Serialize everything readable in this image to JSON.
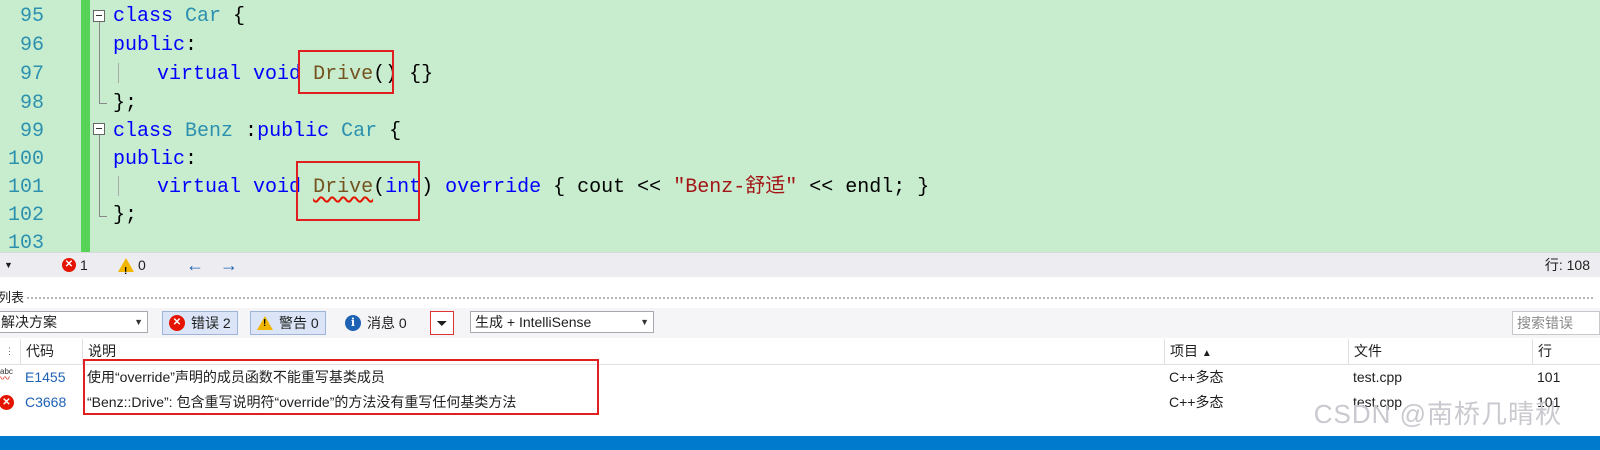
{
  "editor": {
    "lines": [
      {
        "num": "95"
      },
      {
        "num": "96"
      },
      {
        "num": "97"
      },
      {
        "num": "98"
      },
      {
        "num": "99"
      },
      {
        "num": "100"
      },
      {
        "num": "101"
      },
      {
        "num": "102"
      },
      {
        "num": "103"
      }
    ],
    "code": {
      "l95_kw": "class",
      "l95_name": "Car",
      "l95_rest": " {",
      "l96_kw": "public",
      "l96_rest": ":",
      "l97_kw1": "virtual",
      "l97_kw2": "void",
      "l97_fn": "Drive",
      "l97_rest": "() {}",
      "l98": "};",
      "l99_kw": "class",
      "l99_name": "Benz",
      "l99_mid": " :",
      "l99_kw2": "public",
      "l99_base": "Car",
      "l99_rest": " {",
      "l100_kw": "public",
      "l100_rest": ":",
      "l101_kw1": "virtual",
      "l101_kw2": "void",
      "l101_fn": "Drive",
      "l101_p1": "(",
      "l101_int": "int",
      "l101_p2": ")",
      "l101_override": "override",
      "l101_body1": " { cout << ",
      "l101_str": "\"Benz-舒适\"",
      "l101_body2": " << endl; }",
      "l102": "};"
    }
  },
  "status": {
    "errors": "1",
    "warnings": "0",
    "line_info": "行: 108"
  },
  "panel": {
    "title": "列表",
    "scope": "解决方案",
    "errors_btn": "错误 2",
    "warnings_btn": "警告 0",
    "messages_btn": "消息 0",
    "build_filter": "生成 + IntelliSense",
    "search_placeholder": "搜索错误"
  },
  "grid": {
    "headers": {
      "code": "代码",
      "desc": "说明",
      "project": "项目",
      "file": "文件",
      "line": "行"
    },
    "rows": [
      {
        "code": "E1455",
        "desc": "使用“override”声明的成员函数不能重写基类成员",
        "project": "C++多态",
        "file": "test.cpp",
        "line": "101"
      },
      {
        "code": "C3668",
        "desc": "“Benz::Drive”: 包含重写说明符“override”的方法没有重写任何基类方法",
        "project": "C++多态",
        "file": "test.cpp",
        "line": "101"
      }
    ]
  },
  "watermark": "CSDN @南桥几晴秋",
  "colors": {
    "editor_bg": "#c8ecce",
    "change_bar": "#57d457",
    "keyword": "#0000ff",
    "type": "#2b91af",
    "error": "#e51400",
    "highlight_box": "#e02020"
  }
}
